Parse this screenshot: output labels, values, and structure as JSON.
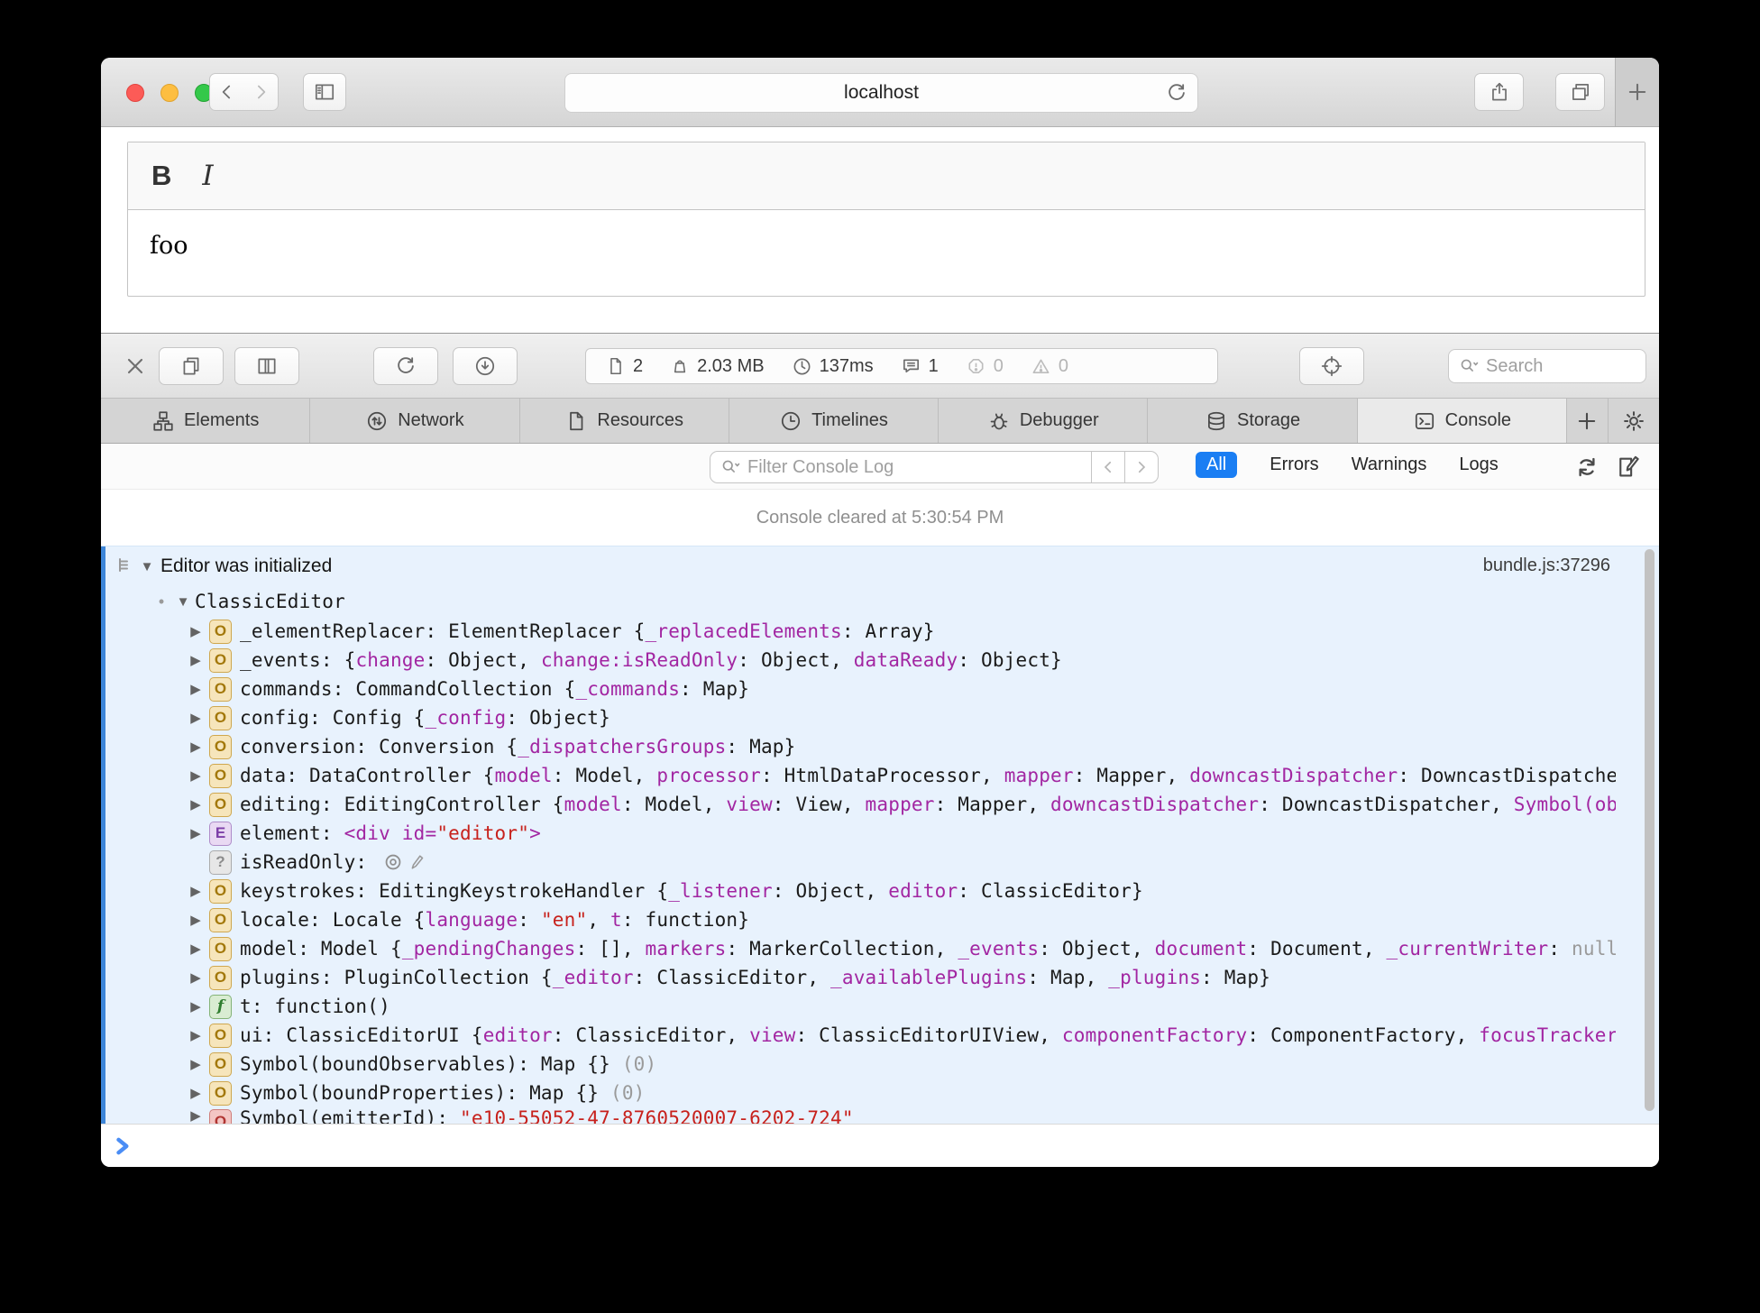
{
  "browser": {
    "url": "localhost"
  },
  "editor": {
    "bold_label": "B",
    "italic_label": "I",
    "content": "foo"
  },
  "devtools": {
    "stats": {
      "documents": "2",
      "size": "2.03 MB",
      "time": "137ms",
      "messages": "1",
      "errors": "0",
      "warnings": "0"
    },
    "search_placeholder": "Search",
    "tabs": [
      {
        "icon": "elements-icon",
        "label": "Elements",
        "selected": false
      },
      {
        "icon": "network-icon",
        "label": "Network",
        "selected": false
      },
      {
        "icon": "resources-icon",
        "label": "Resources",
        "selected": false
      },
      {
        "icon": "timelines-icon",
        "label": "Timelines",
        "selected": false
      },
      {
        "icon": "debugger-icon",
        "label": "Debugger",
        "selected": false
      },
      {
        "icon": "storage-icon",
        "label": "Storage",
        "selected": false
      },
      {
        "icon": "console-tab-icon",
        "label": "Console",
        "selected": true
      }
    ],
    "filter": {
      "placeholder": "Filter Console Log",
      "scopes": [
        {
          "label": "All",
          "selected": true
        },
        {
          "label": "Errors",
          "selected": false
        },
        {
          "label": "Warnings",
          "selected": false
        },
        {
          "label": "Logs",
          "selected": false
        }
      ]
    },
    "console": {
      "cleared_text": "Console cleared at 5:30:54 PM",
      "entry_title": "Editor was initialized",
      "entry_location": "bundle.js:37296",
      "object_name": "ClassicEditor",
      "accent_blue": "#3e86d8",
      "scope_blue": "#1a7ef3",
      "rows": [
        {
          "b": "o",
          "tri": true,
          "parts": [
            [
              "p",
              "_elementReplacer: ElementReplacer {"
            ],
            [
              "k",
              "_replacedElements"
            ],
            [
              "p",
              ": Array}"
            ]
          ]
        },
        {
          "b": "o",
          "tri": true,
          "parts": [
            [
              "p",
              "_events: {"
            ],
            [
              "k",
              "change"
            ],
            [
              "p",
              ": Object, "
            ],
            [
              "k",
              "change:isReadOnly"
            ],
            [
              "p",
              ": Object, "
            ],
            [
              "k",
              "dataReady"
            ],
            [
              "p",
              ": Object}"
            ]
          ]
        },
        {
          "b": "o",
          "tri": true,
          "parts": [
            [
              "p",
              "commands: CommandCollection {"
            ],
            [
              "k",
              "_commands"
            ],
            [
              "p",
              ": Map}"
            ]
          ]
        },
        {
          "b": "o",
          "tri": true,
          "parts": [
            [
              "p",
              "config: Config {"
            ],
            [
              "k",
              "_config"
            ],
            [
              "p",
              ": Object}"
            ]
          ]
        },
        {
          "b": "o",
          "tri": true,
          "parts": [
            [
              "p",
              "conversion: Conversion {"
            ],
            [
              "k",
              "_dispatchersGroups"
            ],
            [
              "p",
              ": Map}"
            ]
          ]
        },
        {
          "b": "o",
          "tri": true,
          "parts": [
            [
              "p",
              "data: DataController {"
            ],
            [
              "k",
              "model"
            ],
            [
              "p",
              ": Model, "
            ],
            [
              "k",
              "processor"
            ],
            [
              "p",
              ": HtmlDataProcessor, "
            ],
            [
              "k",
              "mapper"
            ],
            [
              "p",
              ": Mapper, "
            ],
            [
              "k",
              "downcastDispatcher"
            ],
            [
              "p",
              ": DowncastDispatcher}"
            ]
          ]
        },
        {
          "b": "o",
          "tri": true,
          "parts": [
            [
              "p",
              "editing: EditingController {"
            ],
            [
              "k",
              "model"
            ],
            [
              "p",
              ": Model, "
            ],
            [
              "k",
              "view"
            ],
            [
              "p",
              ": View, "
            ],
            [
              "k",
              "mapper"
            ],
            [
              "p",
              ": Mapper, "
            ],
            [
              "k",
              "downcastDispatcher"
            ],
            [
              "p",
              ": DowncastDispatcher, "
            ],
            [
              "k",
              "Symbol(observable)"
            ]
          ]
        },
        {
          "b": "e",
          "tri": true,
          "parts": [
            [
              "p",
              "element: "
            ],
            [
              "k",
              "<div id="
            ],
            [
              "s",
              "\"editor\""
            ],
            [
              "k",
              ">"
            ]
          ]
        },
        {
          "b": "q",
          "tri": false,
          "icons": true,
          "parts": [
            [
              "p",
              "isReadOnly: "
            ]
          ]
        },
        {
          "b": "o",
          "tri": true,
          "parts": [
            [
              "p",
              "keystrokes: EditingKeystrokeHandler {"
            ],
            [
              "k",
              "_listener"
            ],
            [
              "p",
              ": Object, "
            ],
            [
              "k",
              "editor"
            ],
            [
              "p",
              ": ClassicEditor}"
            ]
          ]
        },
        {
          "b": "o",
          "tri": true,
          "parts": [
            [
              "p",
              "locale: Locale {"
            ],
            [
              "k",
              "language"
            ],
            [
              "p",
              ": "
            ],
            [
              "s",
              "\"en\""
            ],
            [
              "p",
              ", "
            ],
            [
              "k",
              "t"
            ],
            [
              "p",
              ": function}"
            ]
          ]
        },
        {
          "b": "o",
          "tri": true,
          "parts": [
            [
              "p",
              "model: Model {"
            ],
            [
              "k",
              "_pendingChanges"
            ],
            [
              "p",
              ": [], "
            ],
            [
              "k",
              "markers"
            ],
            [
              "p",
              ": MarkerCollection, "
            ],
            [
              "k",
              "_events"
            ],
            [
              "p",
              ": Object, "
            ],
            [
              "k",
              "document"
            ],
            [
              "p",
              ": Document, "
            ],
            [
              "k",
              "_currentWriter"
            ],
            [
              "p",
              ": "
            ],
            [
              "g",
              "null"
            ]
          ]
        },
        {
          "b": "o",
          "tri": true,
          "parts": [
            [
              "p",
              "plugins: PluginCollection {"
            ],
            [
              "k",
              "_editor"
            ],
            [
              "p",
              ": ClassicEditor, "
            ],
            [
              "k",
              "_availablePlugins"
            ],
            [
              "p",
              ": Map, "
            ],
            [
              "k",
              "_plugins"
            ],
            [
              "p",
              ": Map}"
            ]
          ]
        },
        {
          "b": "f",
          "tri": true,
          "parts": [
            [
              "p",
              "t: function()"
            ]
          ]
        },
        {
          "b": "o",
          "tri": true,
          "parts": [
            [
              "p",
              "ui: ClassicEditorUI {"
            ],
            [
              "k",
              "editor"
            ],
            [
              "p",
              ": ClassicEditor, "
            ],
            [
              "k",
              "view"
            ],
            [
              "p",
              ": ClassicEditorUIView, "
            ],
            [
              "k",
              "componentFactory"
            ],
            [
              "p",
              ": ComponentFactory, "
            ],
            [
              "k",
              "focusTracker"
            ]
          ]
        },
        {
          "b": "o",
          "tri": true,
          "parts": [
            [
              "p",
              "Symbol(boundObservables): Map {} "
            ],
            [
              "g",
              "(0)"
            ]
          ]
        },
        {
          "b": "o",
          "tri": true,
          "parts": [
            [
              "p",
              "Symbol(boundProperties): Map {} "
            ],
            [
              "g",
              "(0)"
            ]
          ]
        },
        {
          "b": "r",
          "tri": true,
          "clip": true,
          "parts": [
            [
              "p",
              "Symbol(emitterId): "
            ],
            [
              "s",
              "\"e10-55052-47-8760520007-6202-724\""
            ]
          ]
        }
      ]
    }
  }
}
